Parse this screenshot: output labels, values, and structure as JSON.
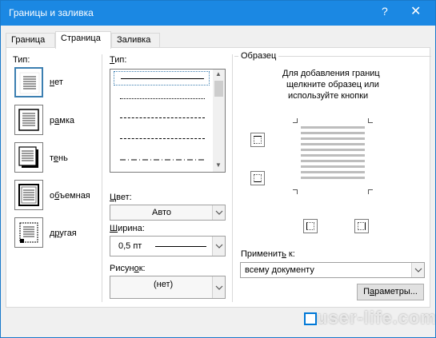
{
  "window": {
    "title": "Границы и заливка",
    "help": "?",
    "close": "✕"
  },
  "tabs": [
    {
      "label": "Граница",
      "active": false
    },
    {
      "label": "Страница",
      "active": true
    },
    {
      "label": "Заливка",
      "active": false
    }
  ],
  "settings": {
    "label": "Тип:",
    "items": [
      {
        "label_u": "н",
        "label_rest": "ет",
        "icon": "border-none-icon",
        "selected": true
      },
      {
        "label_pre": "р",
        "label_u": "а",
        "label_rest": "мка",
        "icon": "border-box-icon",
        "selected": false
      },
      {
        "label_pre": "т",
        "label_u": "е",
        "label_rest": "нь",
        "icon": "border-shadow-icon",
        "selected": false
      },
      {
        "label_pre": "о",
        "label_u": "б",
        "label_rest": "ъемная",
        "icon": "border-3d-icon",
        "selected": false
      },
      {
        "label_pre": "д",
        "label_u": "р",
        "label_rest": "угая",
        "icon": "border-custom-icon",
        "selected": false
      }
    ]
  },
  "style": {
    "label_u": "Т",
    "label_rest": "ип:",
    "line_styles": [
      "solid",
      "dotted",
      "dashed-small",
      "dashed",
      "dash-dot"
    ]
  },
  "color": {
    "label_u": "Ц",
    "label_rest": "вет:",
    "value": "Авто"
  },
  "width": {
    "label_u": "Ш",
    "label_rest": "ирина:",
    "value": "0,5 пт"
  },
  "art": {
    "label_pre": "Рисун",
    "label_u": "о",
    "label_rest": "к:",
    "value": "(нет)"
  },
  "preview": {
    "label": "Образец",
    "hint_line1": "Для добавления границ",
    "hint_line2": "щелкните образец или",
    "hint_line3": "используйте кнопки"
  },
  "apply": {
    "label_pre": "Применит",
    "label_u": "ь",
    "label_rest": " к:",
    "value": "всему документу"
  },
  "options_button": {
    "label_pre": "П",
    "label_u": "а",
    "label_rest": "раметры..."
  },
  "watermark": "user-life.com",
  "colors": {
    "titlebar": "#1b88e3",
    "selection": "#3c7fb1"
  }
}
